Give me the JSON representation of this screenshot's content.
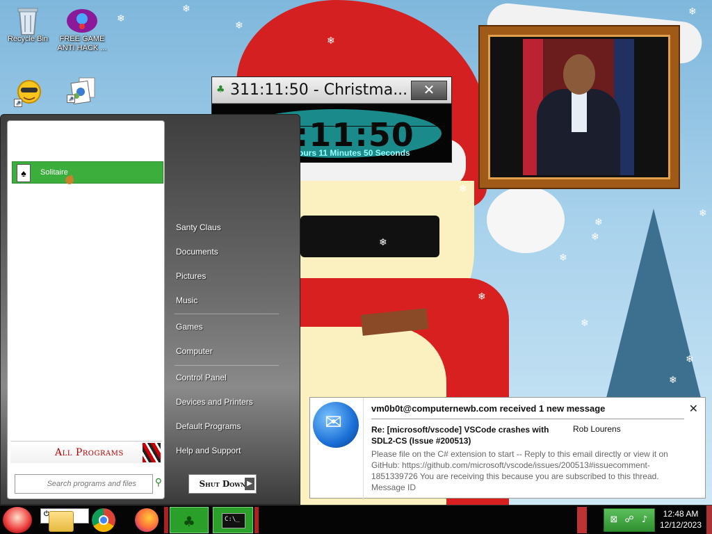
{
  "desktop": {
    "icons": [
      {
        "label": "Recycle Bin",
        "icon": "recycle-bin-icon"
      },
      {
        "label": "FREE GAME ANTI HACK ...",
        "icon": "free-game-icon"
      },
      {
        "label": "",
        "icon": "smiley-shortcut-icon"
      },
      {
        "label": "",
        "icon": "photos-shortcut-icon"
      }
    ]
  },
  "timer_window": {
    "title": "311:11:50 - Christma...",
    "big_time": ":11:50",
    "sub_time": "ours 11 Minutes 50 Seconds",
    "close_glyph": "✕"
  },
  "start_menu": {
    "pinned": [
      {
        "label": "Solitaire",
        "icon": "solitaire-cards-icon"
      }
    ],
    "all_programs_label": "All Programs",
    "search_placeholder": "Search programs and files",
    "right_items": [
      "Santy Claus",
      "Documents",
      "Pictures",
      "Music",
      "Games",
      "Computer",
      "Control Panel",
      "Devices and Printers",
      "Default Programs",
      "Help and Support"
    ],
    "shutdown_label": "Shut Down"
  },
  "notification": {
    "header": "vm0b0t@computernewb.com received 1 new message",
    "subject": "Re: [microsoft/vscode] VSCode crashes with SDL2-CS (Issue #200513)",
    "from": "Rob Lourens",
    "body": "Please file on the C# extension to start -- Reply to this email directly or view it on GitHub: https://github.com/microsoft/vscode/issues/200513#issuecomment-1851339726 You are receiving this because you are subscribed to this thread. Message ID",
    "close_glyph": "✕",
    "app_icon": "thunderbird-icon"
  },
  "taskbar": {
    "start_icon": "santa-start-icon",
    "pinned_apps": [
      "shutdown-mini-icon",
      "file-explorer-icon",
      "chrome-icon",
      "firefox-icon",
      "christmas-tree-icon",
      "command-prompt-icon"
    ],
    "cmd_label": "C:\\_",
    "clock_time": "12:48 AM",
    "clock_date": "12/12/2023"
  }
}
